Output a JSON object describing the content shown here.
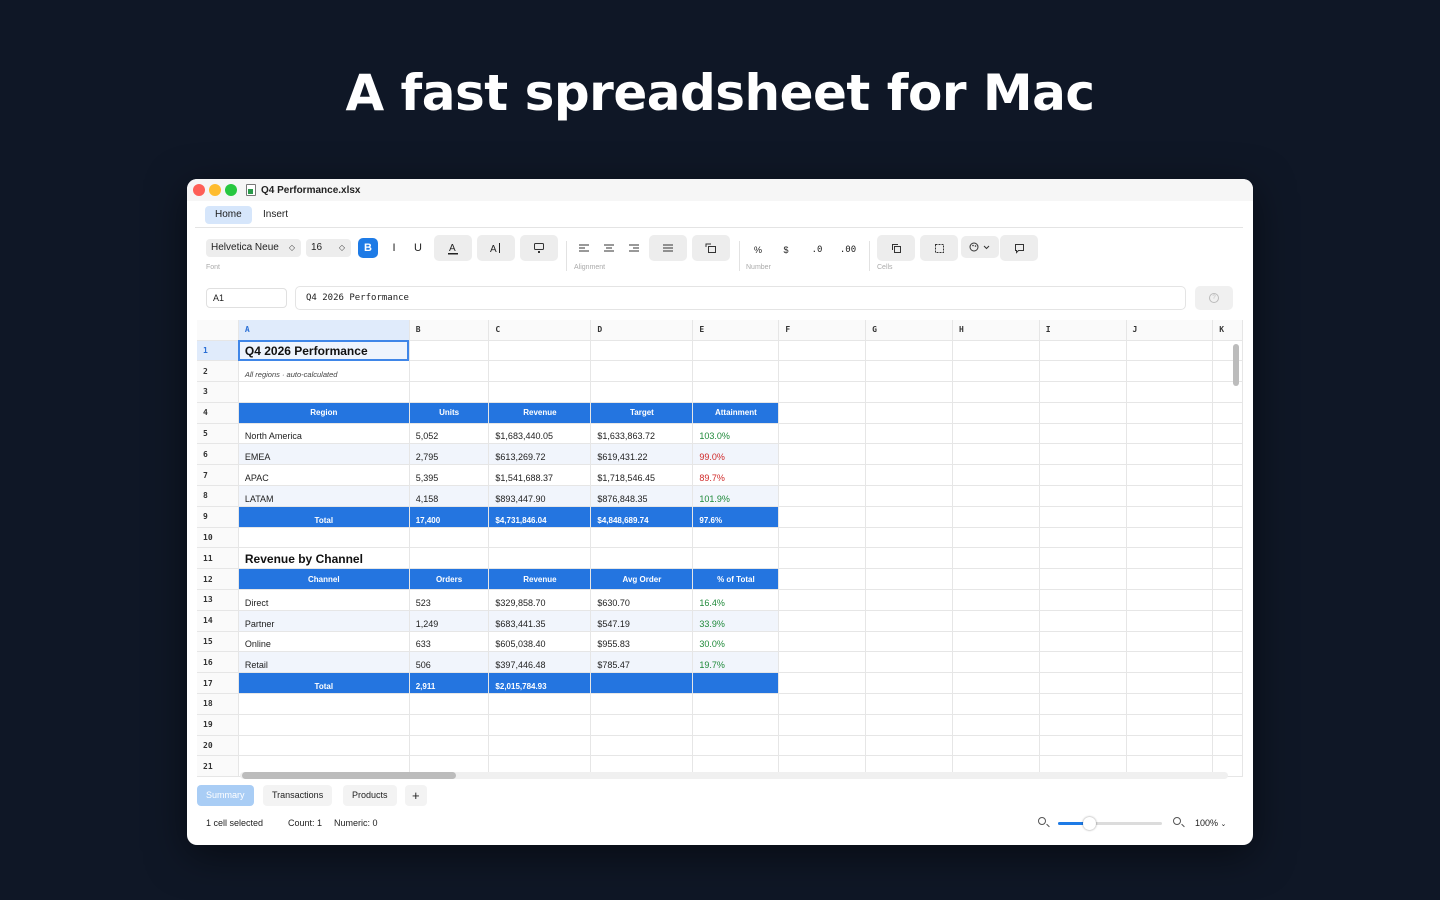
{
  "headline": "A fast spreadsheet for Mac",
  "window": {
    "title": "Q4 Performance.xlsx"
  },
  "ribbon": {
    "tabs": [
      "Home",
      "Insert"
    ],
    "font_name": "Helvetica Neue",
    "font_size": "16",
    "bold": "B",
    "italic": "I",
    "underline": "U",
    "percent": "%",
    "currency": "$",
    "decrease_decimal": ".0",
    "increase_decimal": ".00",
    "groups": [
      "Font",
      "Alignment",
      "Number",
      "Cells"
    ]
  },
  "formula_bar": {
    "cell_ref": "A1",
    "content": "Q4 2026 Performance"
  },
  "grid": {
    "columns": [
      "A",
      "B",
      "C",
      "D",
      "E",
      "F",
      "G",
      "H",
      "I",
      "J",
      "K"
    ],
    "rows": [
      "1",
      "2",
      "3",
      "4",
      "5",
      "6",
      "7",
      "8",
      "9",
      "10",
      "11",
      "12",
      "13",
      "14",
      "15",
      "16",
      "17",
      "18",
      "19",
      "20",
      "21"
    ],
    "title": "Q4 2026 Performance",
    "subtitle": "All regions · auto-calculated",
    "table1": {
      "headers": [
        "Region",
        "Units",
        "Revenue",
        "Target",
        "Attainment"
      ],
      "rows": [
        [
          "North America",
          "5,052",
          "$1,683,440.05",
          "$1,633,863.72",
          "103.0%"
        ],
        [
          "EMEA",
          "2,795",
          "$613,269.72",
          "$619,431.22",
          "99.0%"
        ],
        [
          "APAC",
          "5,395",
          "$1,541,688.37",
          "$1,718,546.45",
          "89.7%"
        ],
        [
          "LATAM",
          "4,158",
          "$893,447.90",
          "$876,848.35",
          "101.9%"
        ]
      ],
      "total": [
        "Total",
        "17,400",
        "$4,731,846.04",
        "$4,848,689.74",
        "97.6%"
      ]
    },
    "section2_title": "Revenue by Channel",
    "table2": {
      "headers": [
        "Channel",
        "Orders",
        "Revenue",
        "Avg Order",
        "% of Total"
      ],
      "rows": [
        [
          "Direct",
          "523",
          "$329,858.70",
          "$630.70",
          "16.4%"
        ],
        [
          "Partner",
          "1,249",
          "$683,441.35",
          "$547.19",
          "33.9%"
        ],
        [
          "Online",
          "633",
          "$605,038.40",
          "$955.83",
          "30.0%"
        ],
        [
          "Retail",
          "506",
          "$397,446.48",
          "$785.47",
          "19.7%"
        ]
      ],
      "total": [
        "Total",
        "2,911",
        "$2,015,784.93",
        "",
        ""
      ]
    }
  },
  "sheet_tabs": [
    "Summary",
    "Transactions",
    "Products"
  ],
  "add_sheet": "+",
  "status": {
    "selection": "1 cell selected",
    "count": "Count: 1",
    "numeric": "Numeric: 0",
    "zoom": "100%",
    "zoom_slider_fraction": 0.3
  },
  "colors": {
    "accent": "#1e7be6",
    "header_blue": "#2475e0",
    "positive": "#1f8a3a",
    "negative": "#d02a2a",
    "background": "#0f1726"
  }
}
